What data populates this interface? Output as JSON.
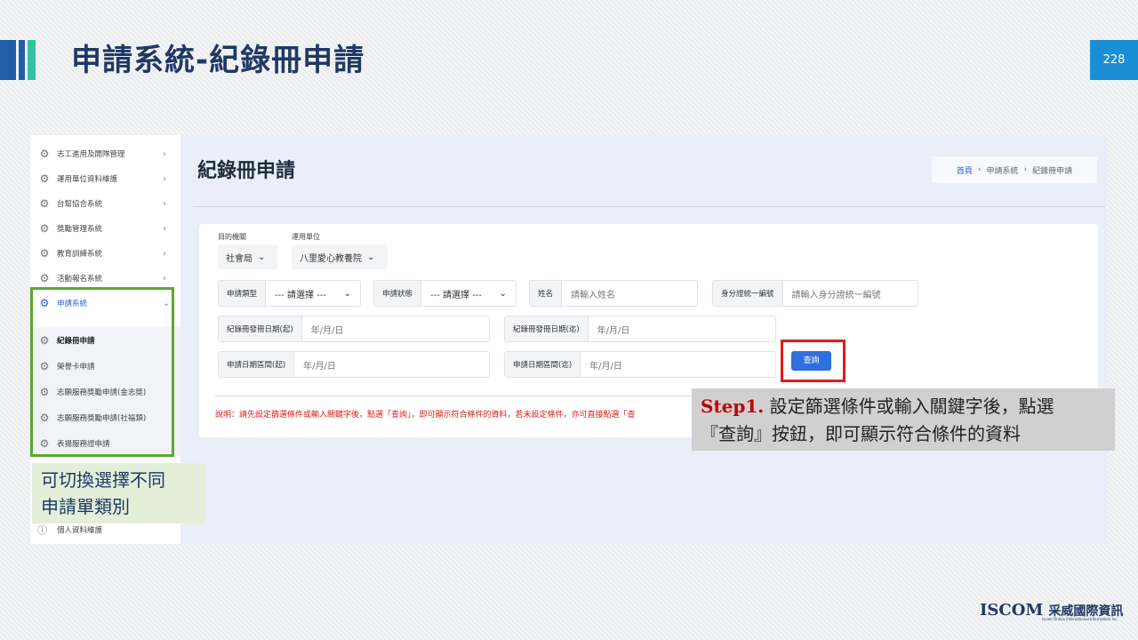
{
  "slide": {
    "title": "申請系統-紀錄冊申請",
    "page_number": "228",
    "colors": {
      "title": "#1f3864",
      "page_badge": "#1a8fd6",
      "accent_green": "#5aa832",
      "accent_red": "#e21a1a"
    }
  },
  "sidebar": {
    "items": [
      {
        "label": "志工進用及開隊管理",
        "icon": "gear-icon"
      },
      {
        "label": "運用單位資料維護",
        "icon": "gear-icon"
      },
      {
        "label": "台幫協合系統",
        "icon": "gear-icon"
      },
      {
        "label": "獎勵管理系統",
        "icon": "gear-icon"
      },
      {
        "label": "教育訓練系統",
        "icon": "gear-icon"
      },
      {
        "label": "活動報名系統",
        "icon": "gear-icon"
      },
      {
        "label": "申請系統",
        "icon": "gear-icon"
      }
    ],
    "sub_items": [
      {
        "label": "紀錄冊申請"
      },
      {
        "label": "榮譽卡申請"
      },
      {
        "label": "志願服務獎勵申請(金志獎)"
      },
      {
        "label": "志願服務獎勵申請(社福類)"
      },
      {
        "label": "表揚服務證申請"
      }
    ],
    "profile": {
      "label": "個人資料維護",
      "icon": "info-icon"
    }
  },
  "annotation_left": {
    "line1": "可切換選擇不同",
    "line2": "申請單類別"
  },
  "main": {
    "title": "紀錄冊申請",
    "breadcrumb": {
      "home": "首頁",
      "level2": "申請系統",
      "current": "紀錄冊申請",
      "sep": "›"
    }
  },
  "filters": {
    "agency_label": "目的機關",
    "agency_value": "社會局",
    "unit_label": "運用單位",
    "unit_value": "八里愛心教養院",
    "apply_type_label": "申請類型",
    "apply_type_value": "--- 請選擇 ---",
    "apply_status_label": "申請狀態",
    "apply_status_value": "--- 請選擇 ---",
    "name_label": "姓名",
    "name_placeholder": "請輸入姓名",
    "id_label": "身分證統一編號",
    "id_placeholder": "請輸入身分證統一編號",
    "issue_start_label": "紀錄冊發冊日期(起)",
    "issue_start_placeholder": "年/月/日",
    "issue_end_label": "紀錄冊發冊日期(迄)",
    "issue_end_placeholder": "年/月/日",
    "apply_start_label": "申請日期區間(起)",
    "apply_start_placeholder": "年/月/日",
    "apply_end_label": "申請日期區間(迄)",
    "apply_end_placeholder": "年/月/日",
    "query_button": "查詢"
  },
  "note": "說明：請先設定篩選條件或輸入關鍵字後，點選「查詢」，即可顯示符合條件的資料，若未設定條件，亦可直接點選「查",
  "callout": {
    "step": "Step1.",
    "line1": " 設定篩選條件或輸入關鍵字後，點選",
    "line2": "『查詢』按鈕，即可顯示符合條件的資料"
  },
  "logo": {
    "brand": "ISCOM",
    "zh": "采威國際資訊",
    "sub": "Iscom Online International Information Inc."
  }
}
